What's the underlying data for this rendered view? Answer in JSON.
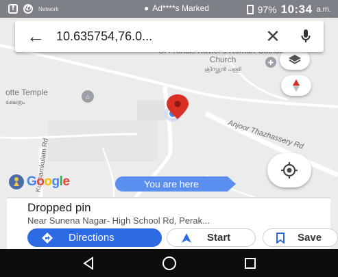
{
  "status_bar": {
    "carrier_text": "Network",
    "center_text": "Ad****s Marked",
    "battery": "97%",
    "time": "10:34",
    "ampm": "a.m."
  },
  "search": {
    "query": "10.635754,76.0..."
  },
  "map": {
    "church_name": "St Francis Xavier's Roman Catholic Church",
    "church_local": "ക്രിസ്ത്യൻ പള്ളി",
    "temple_name": "otte Temple",
    "temple_local": "ക്ഷേത്രം",
    "road_label_1": "Anjoor Thazhassery Rd",
    "road_label_2": "Kunnamkulam Rd",
    "you_are_here": "You are here",
    "logo": "Google"
  },
  "sheet": {
    "title": "Dropped pin",
    "address": "Near Sunena Nagar- High School Rd, Perak...",
    "directions_label": "Directions",
    "start_label": "Start",
    "save_label": "Save"
  },
  "colors": {
    "accent": "#2c6be3",
    "pin": "#d93025",
    "location_dot": "#4285f4"
  },
  "icons": [
    "back-arrow-icon",
    "close-icon",
    "mic-icon",
    "layers-icon",
    "compass-icon",
    "my-location-icon",
    "directions-icon",
    "navigation-icon",
    "bookmark-icon",
    "nav-back-icon",
    "nav-home-icon",
    "nav-recents-icon"
  ]
}
